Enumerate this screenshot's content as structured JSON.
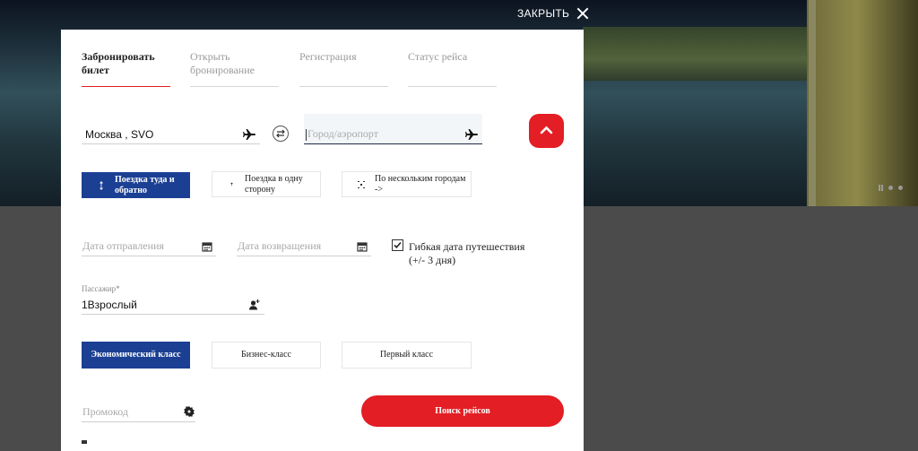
{
  "header": {
    "close_label": "ЗАКРЫТЬ",
    "close_icon": "close-icon"
  },
  "tabs": [
    {
      "label": "Забронировать билет",
      "active": true
    },
    {
      "label": "Открыть бронирование",
      "active": false
    },
    {
      "label": "Регистрация",
      "active": false
    },
    {
      "label": "Статус рейса",
      "active": false
    }
  ],
  "route": {
    "origin_value": "Москва , SVO",
    "destination_placeholder": "Город/аэропорт",
    "origin_icon": "plane-icon",
    "destination_icon": "plane-icon",
    "swap_icon": "swap-arrows-icon",
    "collapse_icon": "chevron-up-icon"
  },
  "trip_types": [
    {
      "label": "Поездка туда и обратно",
      "selected": true,
      "icon": "up-down-arrows-icon"
    },
    {
      "label": "Поездка в одну сторону",
      "selected": false,
      "icon": "single-arrow-icon"
    },
    {
      "label": "По нескольким городам ->",
      "selected": false,
      "icon": "multi-arrows-icon"
    }
  ],
  "dates": {
    "departure_placeholder": "Дата отправления",
    "return_placeholder": "Дата возвращения",
    "calendar_icon": "calendar-icon",
    "flexible_label": "Гибкая дата путешествия (+/- 3 дня)",
    "flexible_checked": true
  },
  "passengers": {
    "label": "Пассажир*",
    "value": "1Взрослый",
    "icon": "add-passenger-icon"
  },
  "cabin_classes": [
    {
      "label": "Экономический класс",
      "selected": true
    },
    {
      "label": "Бизнес-класс",
      "selected": false
    },
    {
      "label": "Первый класс",
      "selected": false
    }
  ],
  "promo": {
    "placeholder": "Промокод",
    "icon": "gear-badge-icon"
  },
  "search_label": "Поиск рейсов",
  "colors": {
    "accent_red": "#e31e24",
    "selected_blue": "#1b3f93",
    "modal_bg": "#ffffff"
  }
}
